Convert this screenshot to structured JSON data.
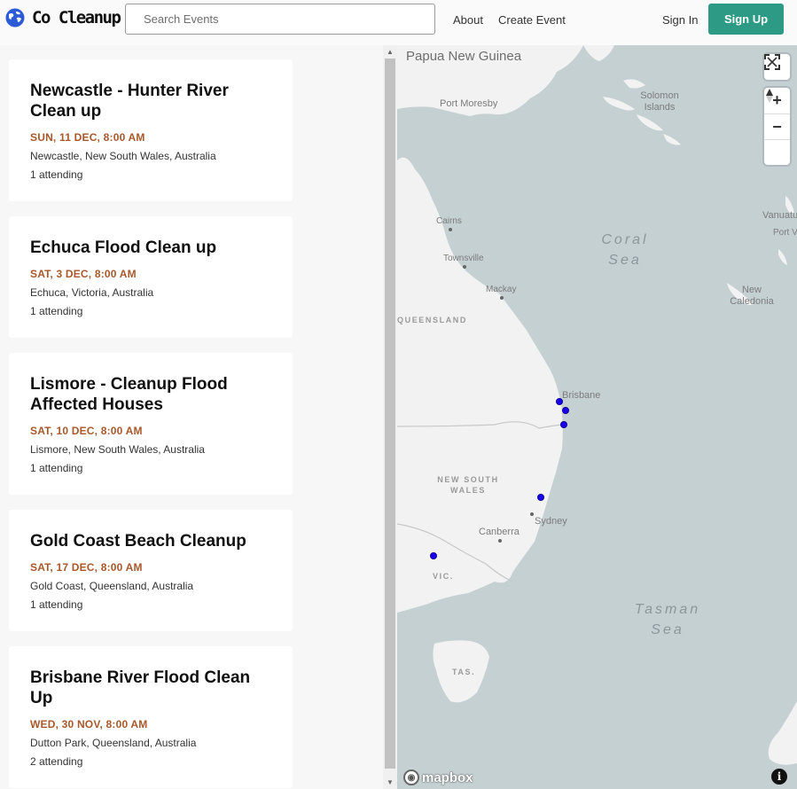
{
  "brand": {
    "name": "Co Cleanup"
  },
  "search": {
    "placeholder": "Search Events"
  },
  "nav": {
    "about": "About",
    "create_event": "Create Event",
    "sign_in": "Sign In",
    "sign_up": "Sign Up"
  },
  "events": [
    {
      "title": "Newcastle - Hunter River Clean up",
      "date": "SUN, 11 DEC, 8:00 AM",
      "location": "Newcastle, New South Wales, Australia",
      "attending": "1 attending"
    },
    {
      "title": "Echuca Flood Clean up",
      "date": "SAT, 3 DEC, 8:00 AM",
      "location": "Echuca, Victoria, Australia",
      "attending": "1 attending"
    },
    {
      "title": "Lismore - Cleanup Flood Affected Houses",
      "date": "SAT, 10 DEC, 8:00 AM",
      "location": "Lismore, New South Wales, Australia",
      "attending": "1 attending"
    },
    {
      "title": "Gold Coast Beach Cleanup",
      "date": "SAT, 17 DEC, 8:00 AM",
      "location": "Gold Coast, Queensland, Australia",
      "attending": "1 attending"
    },
    {
      "title": "Brisbane River Flood Clean Up",
      "date": "WED, 30 NOV, 8:00 AM",
      "location": "Dutton Park, Queensland, Australia",
      "attending": "2 attending"
    }
  ],
  "map": {
    "labels": {
      "papua": "Papua New Guinea",
      "port_moresby": "Port Moresby",
      "solomon": "Solomon Islands",
      "vanuatu": "Vanuatu",
      "port_vila": "Port V",
      "cairns": "Cairns",
      "townsville": "Townsville",
      "mackay": "Mackay",
      "coral_sea": "Coral Sea",
      "new_caledonia": "New Caledonia",
      "queensland": "QUEENSLAND",
      "brisbane": "Brisbane",
      "nsw": "NEW SOUTH WALES",
      "sydney": "Sydney",
      "canberra": "Canberra",
      "vic": "VIC.",
      "tasman_sea": "Tasman Sea",
      "tas": "TAS."
    },
    "attribution": "mapbox",
    "controls": {
      "fullscreen": "fullscreen-icon",
      "zoom_in": "+",
      "zoom_out": "−",
      "compass": "compass-icon"
    },
    "land_color": "#f2f2f2",
    "water_color": "#c5d0d3",
    "marker_color": "#1a00ee"
  },
  "colors": {
    "accent": "#2c9a85",
    "date": "#a8582a"
  }
}
